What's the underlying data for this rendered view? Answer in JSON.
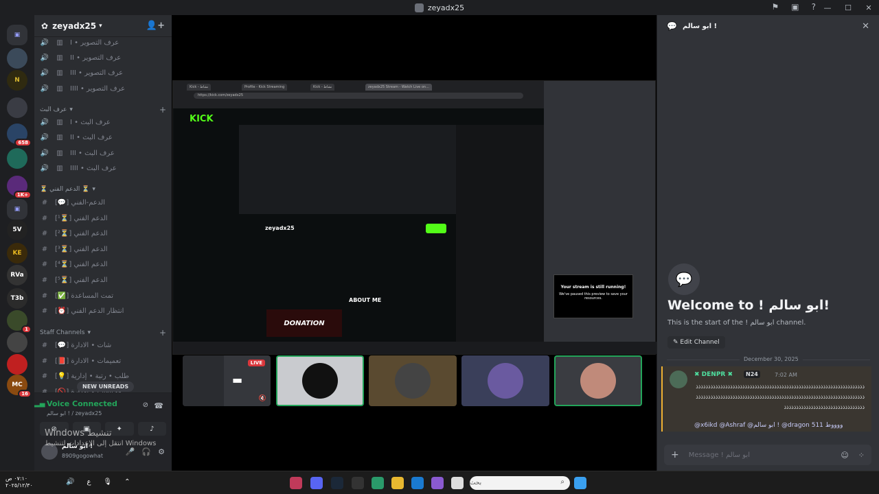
{
  "window": {
    "title": "zeyadx25"
  },
  "server": {
    "name": "zeyadx25"
  },
  "guild_badges": [
    "658",
    "1K+",
    "1",
    "16"
  ],
  "guild_labels": [
    "5V",
    "KE",
    "RVa",
    "T3b",
    "MC"
  ],
  "channels": [
    {
      "name": "عرف التصوير • I",
      "icon": "speaker-icon"
    },
    {
      "name": "عرف التصوير • II",
      "icon": "speaker-icon"
    },
    {
      "name": "عرف التصوير • III",
      "icon": "speaker-icon"
    },
    {
      "name": "عرف التصوير • IIII",
      "icon": "speaker-icon"
    }
  ],
  "cat1": "عرف البث",
  "channels2": [
    {
      "name": "عرف البث • I"
    },
    {
      "name": "عرف البث • II"
    },
    {
      "name": "عرف البث • III"
    },
    {
      "name": "عرف البث • IIII"
    }
  ],
  "cat2": "⏳ الدعم الفني ⏳",
  "support": [
    {
      "name": "الدعم-الفني [💬]"
    },
    {
      "name": "الدعم الفني [⏳¹]"
    },
    {
      "name": "الدعم الفني [⏳²]"
    },
    {
      "name": "الدعم الفني [⏳³]"
    },
    {
      "name": "الدعم الفني [⏳⁴]"
    },
    {
      "name": "الدعم الفني [⏳⁵]"
    },
    {
      "name": "تمت المساعدة [✅]"
    },
    {
      "name": "انتظار الدعم الفني [⏰]"
    }
  ],
  "cat3": "Staff Channels",
  "staff": [
    {
      "name": "شات • الادارة [💬]"
    },
    {
      "name": "تعميمات • الادارة [📕]"
    },
    {
      "name": "طلب • رتبة • إدارية [💡]"
    },
    {
      "name": "مخالفات • الادارة [🚫]"
    }
  ],
  "new_unreads": "NEW UNREADS",
  "voice": {
    "status": "Voice Connected",
    "sub": "ابو سالم ! / zeyadx25"
  },
  "user": {
    "name": "ابو سالم !",
    "status": "8909gogowhat"
  },
  "watermark": {
    "line1": "Windows تنشيط",
    "line2": "انتقل إلى الإعدادات لتنشيط Windows"
  },
  "stream": {
    "tabs": [
      "Kick - نشاط",
      "Profile - Kick Streaming",
      "Kick - نشاط",
      "zeyadx25 Stream - Watch Live on..."
    ],
    "url": "https://kick.com/zeyadx25",
    "kick_logo": "KICK",
    "streamer": "zeyadx25",
    "about": "ABOUT ME",
    "donation": "DONATION",
    "still_running_title": "Your stream is still running!",
    "still_running_sub": "We've paused this preview to save your resources."
  },
  "live_label": "LIVE",
  "chat": {
    "header": "ابو سالم !",
    "welcome_title": "Welcome to ! ابو سالم!",
    "welcome_sub": "This is the start of the ! ابو سالم channel.",
    "edit_channel": "Edit Channel",
    "date": "December 30, 2025",
    "author": "✖ DENPR ✖",
    "tag": "N24",
    "time": "7:02 AM",
    "body": "ذذذذذذذذذذذذذذذذذذذذذذذذذذذذذذذذذذذذذذذذذذذذذذذذذذذذذذذذذذذذذذذذذذذذذذذذذذذذذذذذذذذذذذذذذذذذذذذذذذذذذذذذذذذذذذذذذذذذذذذذذذذذذذذذذذذذذذذذذذذذذذذذذذذذذذذذذذذذذذذذذذذذذذذذذذذ",
    "mentions": "@x6ikd @Ashraf @ابو سالم ! @dragon 511 ووووط",
    "placeholder": "Message ! ابو سالم"
  },
  "taskbar": {
    "search": "بحث",
    "time": "٠٧:١٠ ص",
    "date": "٢٠٢٥/١٢/٣٠",
    "lang": "ع"
  },
  "colors": {
    "accent": "#5865f2",
    "online": "#23a55a",
    "kick": "#53fc18",
    "danger": "#da373c"
  }
}
